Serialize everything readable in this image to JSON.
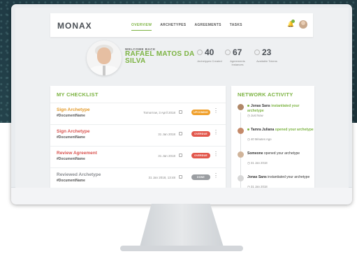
{
  "app": {
    "logo": "MONAX"
  },
  "nav": {
    "items": [
      "OVERVIEW",
      "ARCHETYPES",
      "AGREEMENTS",
      "TASKS"
    ],
    "active": 0
  },
  "header": {
    "notification_count": ""
  },
  "profile": {
    "welcome": "WELCOME BACK",
    "name": "RAFAEL MATOS DA SILVA"
  },
  "stats": [
    {
      "value": "40",
      "label": "Archetypes Created",
      "icon": "file-icon"
    },
    {
      "value": "67",
      "label": "Agreements Instances",
      "icon": "agreement-icon"
    },
    {
      "value": "23",
      "label": "Available Tokens",
      "icon": "token-icon"
    }
  ],
  "checklist": {
    "title": "MY CHECKLIST",
    "rows": [
      {
        "title": "Sign Archetype",
        "sub": "#DocumentName",
        "date": "Tomorrow, 3 April 2018",
        "status": "UPCOMING",
        "title_color": "#e39a2a",
        "badge_color": "#f0a02c"
      },
      {
        "title": "Sign Archetype",
        "sub": "#DocumentName",
        "date": "31 Jan 2018",
        "status": "OVERDUE",
        "title_color": "#d9534f",
        "badge_color": "#e2574c"
      },
      {
        "title": "Review Agreement",
        "sub": "#DocumentName",
        "date": "31 Jan 2018",
        "status": "OVERDUE",
        "title_color": "#d9534f",
        "badge_color": "#e2574c"
      },
      {
        "title": "Reviewed Archetype",
        "sub": "#DocumentName",
        "date": "31 Jan 2018, 13:48",
        "status": "DONE",
        "title_color": "#8a8d91",
        "badge_color": "#9b9ea2"
      }
    ]
  },
  "activity": {
    "title": "NETWORK ACTIVITY",
    "items": [
      {
        "who": "Jonas Sans",
        "action": "instantiated your archetype",
        "time": "Just Now"
      },
      {
        "who": "Tamra Juliana",
        "action": "opened your archetype",
        "time": "40 Minutes Ago"
      },
      {
        "who": "Someone",
        "action": "opened your archetype",
        "time": "31 Jan 2018"
      },
      {
        "who": "Jonas Sans",
        "action": "instantiated your archetype",
        "time": "31 Jan 2018"
      }
    ]
  }
}
